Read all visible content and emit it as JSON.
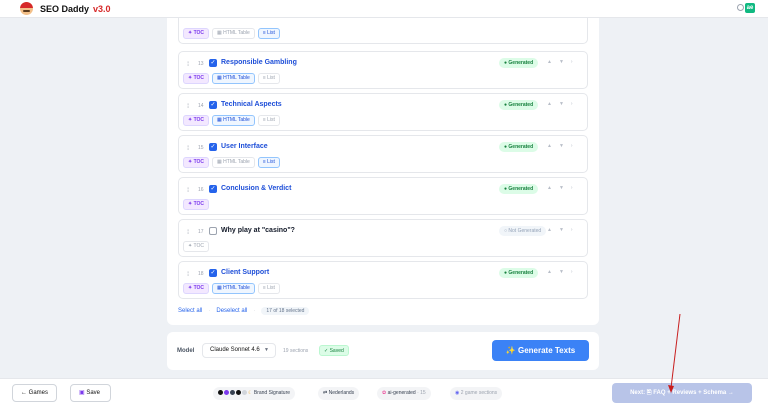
{
  "app": {
    "name": "SEO Daddy",
    "version": "v3.0",
    "badge": "ae"
  },
  "sections": [
    {
      "num": "",
      "title": "",
      "checked": true,
      "status": "",
      "partial": true,
      "tags": [
        {
          "label": "✦ TOC",
          "state": "toc"
        },
        {
          "label": "▦ HTML Table",
          "state": "off"
        },
        {
          "label": "≡ List",
          "state": "on"
        }
      ]
    },
    {
      "num": "13",
      "title": "Responsible Gambling",
      "checked": true,
      "status": "● Generated",
      "tags": [
        {
          "label": "✦ TOC",
          "state": "toc"
        },
        {
          "label": "▦ HTML Table",
          "state": "on"
        },
        {
          "label": "≡ List",
          "state": "off"
        }
      ]
    },
    {
      "num": "14",
      "title": "Technical Aspects",
      "checked": true,
      "status": "● Generated",
      "tags": [
        {
          "label": "✦ TOC",
          "state": "toc"
        },
        {
          "label": "▦ HTML Table",
          "state": "on"
        },
        {
          "label": "≡ List",
          "state": "off"
        }
      ]
    },
    {
      "num": "15",
      "title": "User Interface",
      "checked": true,
      "status": "● Generated",
      "tags": [
        {
          "label": "✦ TOC",
          "state": "toc"
        },
        {
          "label": "▦ HTML Table",
          "state": "off"
        },
        {
          "label": "≡ List",
          "state": "on"
        }
      ]
    },
    {
      "num": "16",
      "title": "Conclusion & Verdict",
      "checked": true,
      "status": "● Generated",
      "tags": [
        {
          "label": "✦ TOC",
          "state": "toc"
        }
      ]
    },
    {
      "num": "17",
      "title": "Why play at \"casino\"?",
      "checked": false,
      "status": "○ Not Generated",
      "tags": [
        {
          "label": "✦ TOC",
          "state": "tocoff"
        }
      ]
    },
    {
      "num": "18",
      "title": "Client Support",
      "checked": true,
      "status": "● Generated",
      "tags": [
        {
          "label": "✦ TOC",
          "state": "toc"
        },
        {
          "label": "▦ HTML Table",
          "state": "on"
        },
        {
          "label": "≡ List",
          "state": "off"
        }
      ]
    }
  ],
  "selection": {
    "select_all": "Select all",
    "deselect_all": "Deselect all",
    "count": "17 of 18 selected"
  },
  "generate": {
    "model_label": "Model",
    "model_value": "Claude Sonnet 4.6",
    "sections": "19 sections",
    "saved": "✓ Saved",
    "button": "✨ Generate Texts"
  },
  "footer": {
    "back": "← Games",
    "save": "Save",
    "brand_signature": "Brand Signature",
    "language": "Nederlands",
    "ai_generated": "ai-generated",
    "ai_count": "· 15",
    "game_sections": "2 game sections",
    "next": "Next: 🖹 FAQ + Reviews + Schema →"
  },
  "colors": {
    "accent": "#3b82f6",
    "generated": "#15803d",
    "brand": "#d62828"
  }
}
